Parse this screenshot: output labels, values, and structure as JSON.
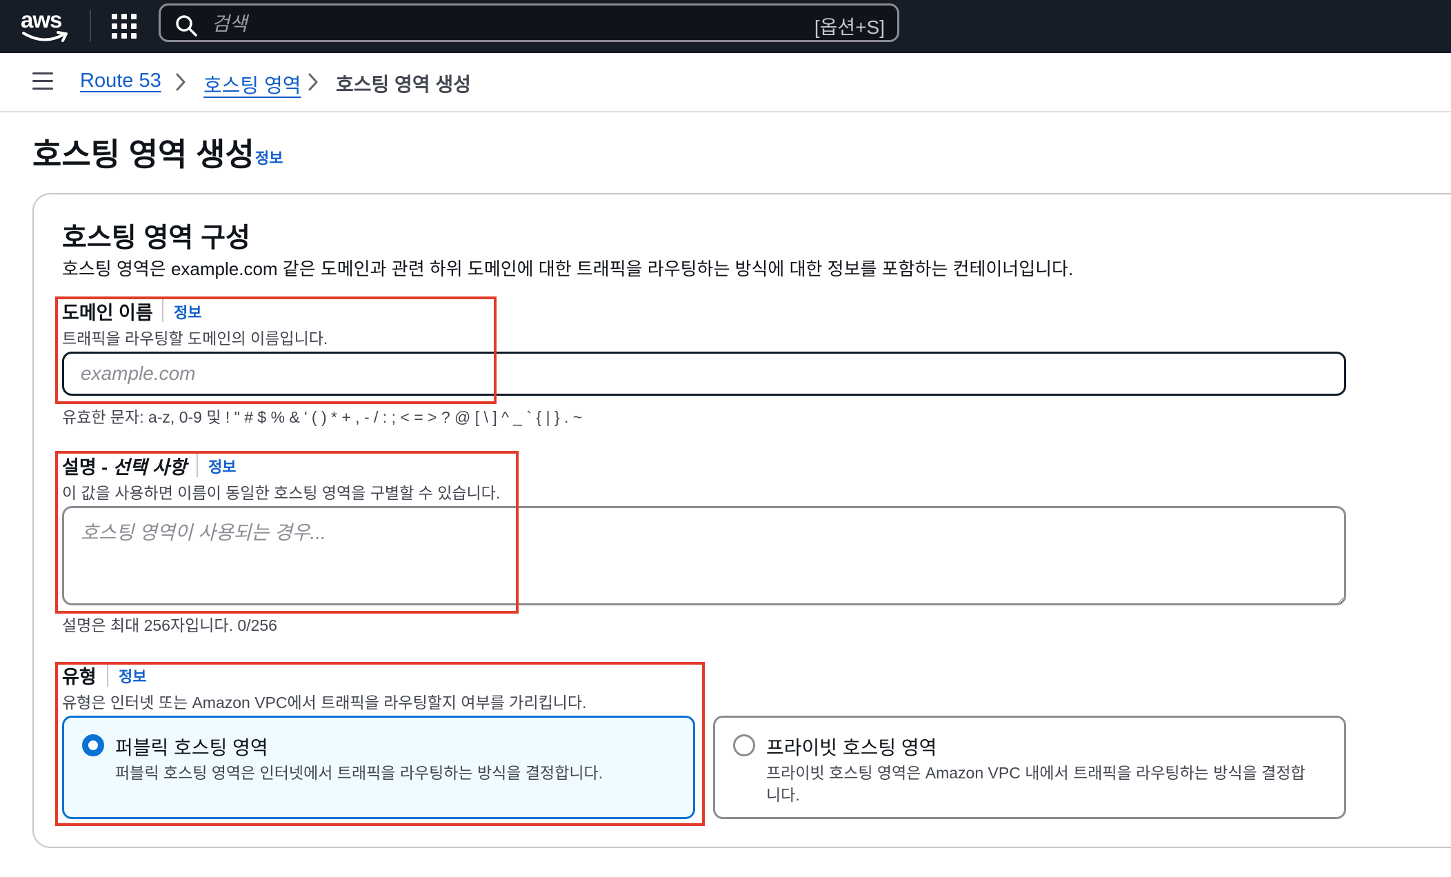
{
  "topnav": {
    "logo_text": "aws",
    "search_placeholder": "검색",
    "search_shortcut": "[옵션+S]"
  },
  "breadcrumb": {
    "items": [
      "Route 53",
      "호스팅 영역"
    ],
    "current": "호스팅 영역 생성"
  },
  "page": {
    "title": "호스팅 영역 생성",
    "info": "정보"
  },
  "section": {
    "title": "호스팅 영역 구성",
    "description": "호스팅 영역은 example.com 같은 도메인과 관련 하위 도메인에 대한 트래픽을 라우팅하는 방식에 대한 정보를 포함하는 컨테이너입니다."
  },
  "domain_name": {
    "label": "도메인 이름",
    "info": "정보",
    "hint": "트래픽을 라우팅할 도메인의 이름입니다.",
    "placeholder": "example.com",
    "constraint": "유효한 문자: a-z, 0-9 및 ! \" # $ % & ' ( ) * + , - / : ; < = > ? @ [ \\ ] ^ _ ` { | } . ~"
  },
  "description_field": {
    "label_main": "설명 - ",
    "label_optional": "선택 사항",
    "info": "정보",
    "hint": "이 값을 사용하면 이름이 동일한 호스팅 영역을 구별할 수 있습니다.",
    "placeholder": "호스팅 영역이 사용되는 경우...",
    "constraint": "설명은 최대 256자입니다. 0/256"
  },
  "type_field": {
    "label": "유형",
    "info": "정보",
    "hint": "유형은 인터넷 또는 Amazon VPC에서 트래픽을 라우팅할지 여부를 가리킵니다.",
    "options": [
      {
        "title": "퍼블릭 호스팅 영역",
        "description": "퍼블릭 호스팅 영역은 인터넷에서 트래픽을 라우팅하는 방식을 결정합니다.",
        "selected": true
      },
      {
        "title": "프라이빗 호스팅 영역",
        "description": "프라이빗 호스팅 영역은 Amazon VPC 내에서 트래픽을 라우팅하는 방식을 결정합니다.",
        "selected": false
      }
    ]
  },
  "colors": {
    "nav_bg": "#161d26",
    "link": "#0f5ecc",
    "selected_border": "#0972d3",
    "selected_bg": "#f0fbff",
    "annotation_red": "#e23b2a"
  }
}
